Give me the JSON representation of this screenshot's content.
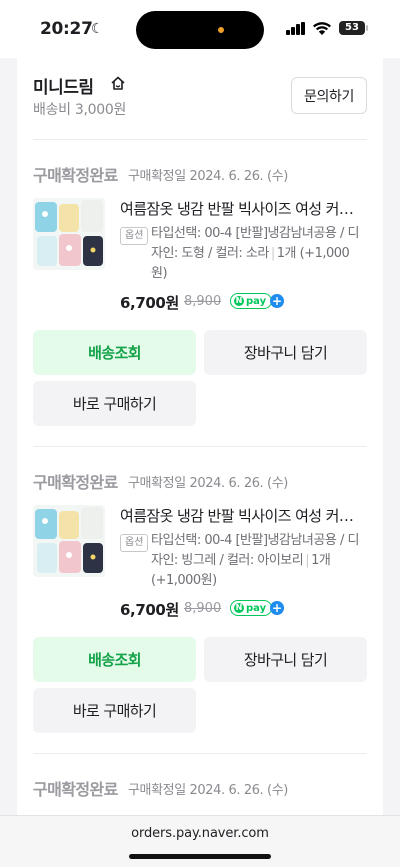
{
  "status_bar": {
    "time": "20:27",
    "battery": "53"
  },
  "seller": {
    "name": "미니드림",
    "shipping": "배송비 3,000원",
    "inquiry_label": "문의하기"
  },
  "orders": [
    {
      "status": "구매확정완료",
      "date": "구매확정일 2024. 6. 26. (수)",
      "title": "여름잠옷 냉감 반팔 빅사이즈 여성 커플 잠옷세트",
      "option_badge": "옵션",
      "option": "타입선택: 00-4 [반팔]냉감남녀공용 / 디자인: 도형 / 컬러: 소라",
      "quantity": "1개 (+1,000원)",
      "price": "6,700원",
      "original_price": "8,900",
      "btn_tracking": "배송조회",
      "btn_cart": "장바구니 담기",
      "btn_buy": "바로 구매하기"
    },
    {
      "status": "구매확정완료",
      "date": "구매확정일 2024. 6. 26. (수)",
      "title": "여름잠옷 냉감 반팔 빅사이즈 여성 커플 잠옷세트",
      "option_badge": "옵션",
      "option": "타입선택: 00-4 [반팔]냉감남녀공용 / 디자인: 빙그레 / 컬러: 아이보리",
      "quantity": "1개 (+1,000원)",
      "price": "6,700원",
      "original_price": "8,900",
      "btn_tracking": "배송조회",
      "btn_cart": "장바구니 담기",
      "btn_buy": "바로 구매하기"
    },
    {
      "status": "구매확정완료",
      "date": "구매확정일 2024. 6. 26. (수)"
    }
  ],
  "npay": {
    "label": "pay",
    "n": "N",
    "plus": "+"
  },
  "url_bar": {
    "url": "orders.pay.naver.com"
  },
  "colors": {
    "accent_green": "#03c75a",
    "button_green_text": "#15a34a",
    "npay_plus_blue": "#1f8cf0"
  }
}
